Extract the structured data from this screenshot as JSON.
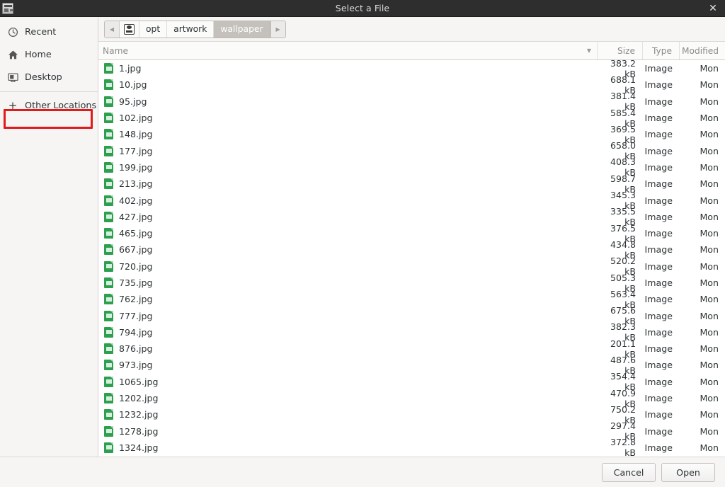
{
  "window": {
    "title": "Select a File",
    "close_label": "✕",
    "app_icon": "window-icon"
  },
  "sidebar": {
    "items": [
      {
        "label": "Recent",
        "icon": "clock-icon",
        "highlighted": false
      },
      {
        "label": "Home",
        "icon": "home-icon",
        "highlighted": false
      },
      {
        "label": "Desktop",
        "icon": "desktop-icon",
        "highlighted": false
      },
      {
        "label": "Other Locations",
        "icon": "plus-icon",
        "highlighted": true
      }
    ]
  },
  "pathbar": {
    "prev_label": "◀",
    "next_label": "▶",
    "crumbs": [
      {
        "label": "",
        "icon": "device-icon",
        "active": false
      },
      {
        "label": "opt",
        "active": false
      },
      {
        "label": "artwork",
        "active": false
      },
      {
        "label": "wallpaper",
        "active": true
      }
    ]
  },
  "columns": {
    "name": "Name",
    "size": "Size",
    "type": "Type",
    "modified": "Modified",
    "sort_caret": "▼"
  },
  "files": [
    {
      "name": "1.jpg",
      "size": "383.2 kB",
      "type": "Image",
      "modified": "Mon"
    },
    {
      "name": "10.jpg",
      "size": "688.1 kB",
      "type": "Image",
      "modified": "Mon"
    },
    {
      "name": "95.jpg",
      "size": "381.4 kB",
      "type": "Image",
      "modified": "Mon"
    },
    {
      "name": "102.jpg",
      "size": "585.4 kB",
      "type": "Image",
      "modified": "Mon"
    },
    {
      "name": "148.jpg",
      "size": "369.5 kB",
      "type": "Image",
      "modified": "Mon"
    },
    {
      "name": "177.jpg",
      "size": "658.0 kB",
      "type": "Image",
      "modified": "Mon"
    },
    {
      "name": "199.jpg",
      "size": "408.3 kB",
      "type": "Image",
      "modified": "Mon"
    },
    {
      "name": "213.jpg",
      "size": "598.7 kB",
      "type": "Image",
      "modified": "Mon"
    },
    {
      "name": "402.jpg",
      "size": "345.3 kB",
      "type": "Image",
      "modified": "Mon"
    },
    {
      "name": "427.jpg",
      "size": "335.5 kB",
      "type": "Image",
      "modified": "Mon"
    },
    {
      "name": "465.jpg",
      "size": "376.5 kB",
      "type": "Image",
      "modified": "Mon"
    },
    {
      "name": "667.jpg",
      "size": "434.8 kB",
      "type": "Image",
      "modified": "Mon"
    },
    {
      "name": "720.jpg",
      "size": "520.2 kB",
      "type": "Image",
      "modified": "Mon"
    },
    {
      "name": "735.jpg",
      "size": "505.3 kB",
      "type": "Image",
      "modified": "Mon"
    },
    {
      "name": "762.jpg",
      "size": "563.4 kB",
      "type": "Image",
      "modified": "Mon"
    },
    {
      "name": "777.jpg",
      "size": "675.6 kB",
      "type": "Image",
      "modified": "Mon"
    },
    {
      "name": "794.jpg",
      "size": "382.3 kB",
      "type": "Image",
      "modified": "Mon"
    },
    {
      "name": "876.jpg",
      "size": "201.1 kB",
      "type": "Image",
      "modified": "Mon"
    },
    {
      "name": "973.jpg",
      "size": "487.6 kB",
      "type": "Image",
      "modified": "Mon"
    },
    {
      "name": "1065.jpg",
      "size": "354.4 kB",
      "type": "Image",
      "modified": "Mon"
    },
    {
      "name": "1202.jpg",
      "size": "470.9 kB",
      "type": "Image",
      "modified": "Mon"
    },
    {
      "name": "1232.jpg",
      "size": "750.2 kB",
      "type": "Image",
      "modified": "Mon"
    },
    {
      "name": "1278.jpg",
      "size": "297.4 kB",
      "type": "Image",
      "modified": "Mon"
    },
    {
      "name": "1324.jpg",
      "size": "372.8 kB",
      "type": "Image",
      "modified": "Mon"
    }
  ],
  "actions": {
    "cancel_label": "Cancel",
    "open_label": "Open"
  },
  "colors": {
    "titlebar_bg": "#2e2e2e",
    "chrome_bg": "#f6f5f4",
    "file_icon_green": "#2e9e4f",
    "highlight_red": "#e01b1b",
    "crumb_active_bg": "#c4c0bc"
  }
}
